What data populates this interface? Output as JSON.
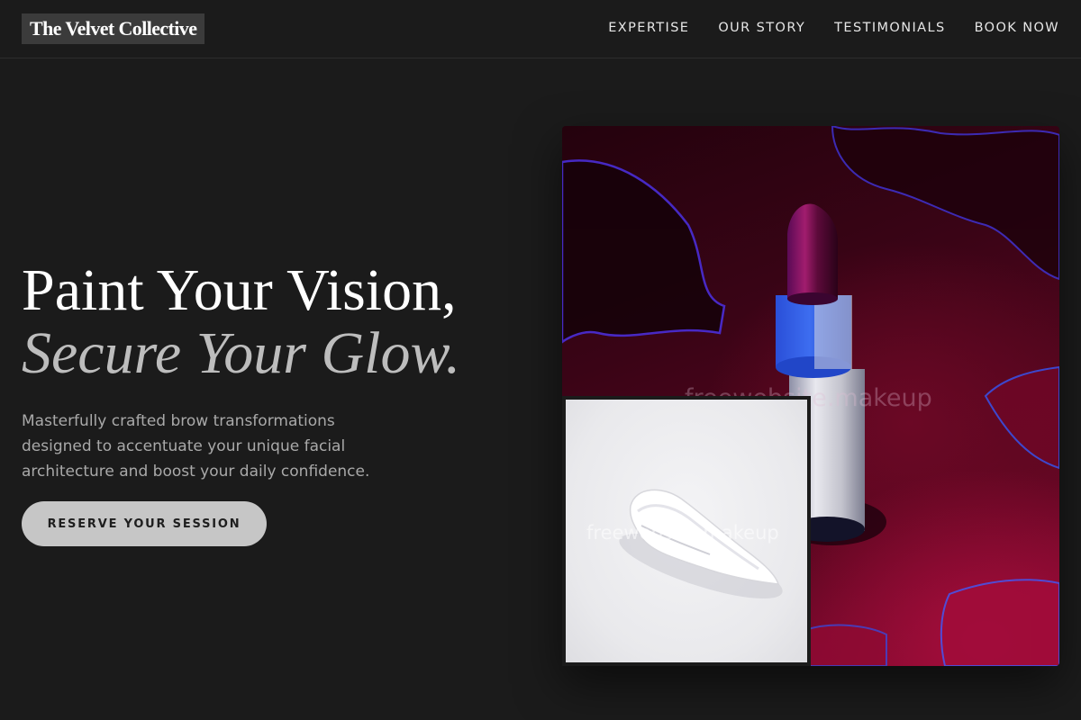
{
  "header": {
    "logo": "The Velvet Collective",
    "nav": [
      "EXPERTISE",
      "OUR STORY",
      "TESTIMONIALS",
      "BOOK NOW"
    ]
  },
  "hero": {
    "title_line1": "Paint Your Vision,",
    "title_line2": "Secure Your Glow.",
    "subtitle": "Masterfully crafted brow transformations designed to accentuate your unique facial architecture and boost your daily confidence.",
    "cta": "RESERVE YOUR SESSION"
  },
  "images": {
    "main_watermark": "freewebsite.makeup",
    "small_watermark": "freewebsite.makeup"
  },
  "colors": {
    "background": "#1b1b1b",
    "cta_background": "#c6c6c6",
    "accent_red": "#8a0a33",
    "lipstick_blue": "#2f5fe0"
  }
}
